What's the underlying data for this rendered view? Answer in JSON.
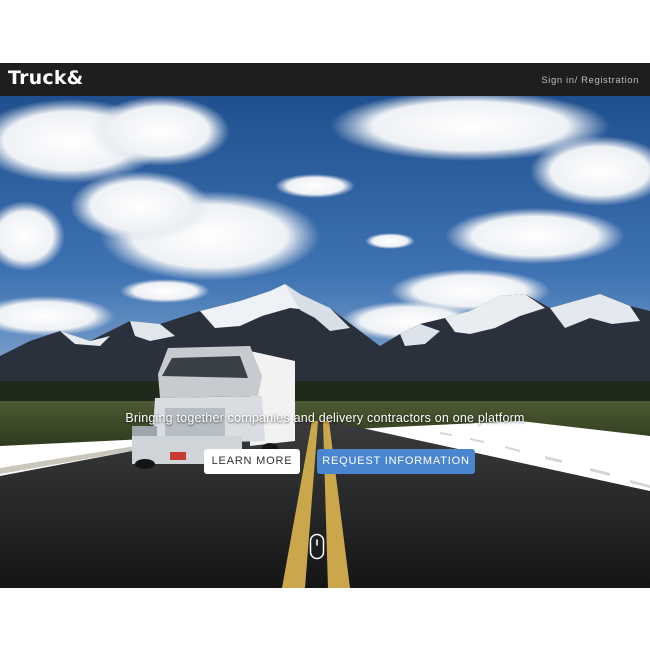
{
  "navbar": {
    "logo": "Truck&",
    "signin_link": "Sign in/ Registration"
  },
  "hero": {
    "tagline": "Bringing together companies and delivery contractors on one platform",
    "learn_more_button": "LEARN MORE",
    "request_info_button": "REQUEST INFORMATION"
  },
  "icons": {
    "scroll": "mouse-scroll-icon"
  },
  "colors": {
    "navbar_bg": "#1e1e1e",
    "primary_button": "#4a86cf",
    "secondary_button": "#ffffff"
  }
}
